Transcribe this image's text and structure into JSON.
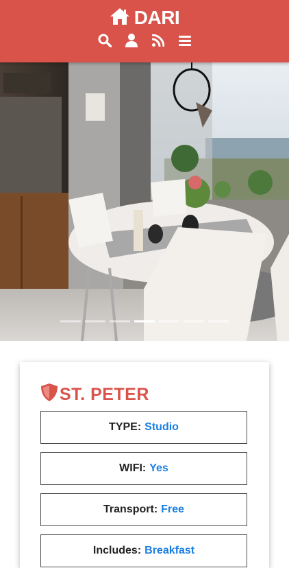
{
  "header": {
    "brand": "DARI",
    "icons": [
      "home-icon",
      "search-icon",
      "user-icon",
      "rss-icon",
      "menu-icon"
    ]
  },
  "colors": {
    "primary": "#d9534a",
    "link": "#1a7fe3"
  },
  "carousel": {
    "slides": 7,
    "active_index": 3
  },
  "listing": {
    "name": "ST. PETER",
    "details": [
      {
        "label": "TYPE:",
        "value": "Studio"
      },
      {
        "label": "WIFI:",
        "value": "Yes"
      },
      {
        "label": "Transport:",
        "value": "Free"
      },
      {
        "label": "Includes:",
        "value": "Breakfast"
      }
    ]
  }
}
